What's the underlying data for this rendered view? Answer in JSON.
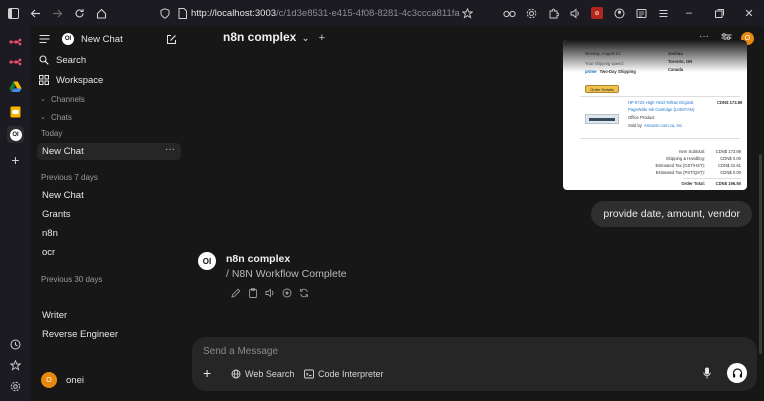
{
  "browser": {
    "url_host": "http://localhost:3003",
    "url_path": "/c/1d3e8531-e415-4f08-8281-4c3ccca811fa"
  },
  "sidebar": {
    "new_chat": "New Chat",
    "search": "Search",
    "workspace": "Workspace",
    "channels": "Channels",
    "chats": "Chats",
    "section_today": "Today",
    "today_items": [
      {
        "label": "New Chat"
      }
    ],
    "section_prev7": "Previous 7 days",
    "prev7_items": [
      {
        "label": "New Chat"
      },
      {
        "label": "Grants"
      },
      {
        "label": "n8n"
      },
      {
        "label": "ocr"
      }
    ],
    "section_prev30": "Previous 30 days",
    "prev30_items": [
      {
        "label": "Writer"
      },
      {
        "label": "Reverse Engineer"
      }
    ],
    "user_name": "onei",
    "user_initial": "O"
  },
  "header": {
    "model_name": "n8n complex",
    "avatar_initial": "O"
  },
  "receipt": {
    "date_line": "Monday, August 21",
    "speed_label": "Your shipping speed:",
    "prime_label": "prime",
    "speed_value": "Two-Day Shipping",
    "order_details": "Order Details",
    "ship_to_name": "Joshua",
    "ship_to_city": "Toronto, ON",
    "ship_to_country": "Canada",
    "item_title_1": "HP 972X High Yield Yellow Original",
    "item_title_2": "PageWide Ink Cartridge (L0S07AN)",
    "item_category": "Office Product",
    "sold_by_label": "Sold by",
    "sold_by_value": "Amazon.com.ca, Inc.",
    "item_price": "CDN$ 173.89",
    "totals": [
      {
        "label": "Item Subtotal:",
        "value": "CDN$ 173.89"
      },
      {
        "label": "Shipping & Handling:",
        "value": "CDN$ 0.00"
      },
      {
        "label": "Estimated Tax (GST/HST):",
        "value": "CDN$ 22.61"
      },
      {
        "label": "Estimated Tax (PST/QST):",
        "value": "CDN$ 0.00"
      }
    ],
    "order_total_label": "Order Total:",
    "order_total_value": "CDN$ 196.50"
  },
  "chat": {
    "user_message": "provide date, amount, vendor",
    "assistant_name": "n8n complex",
    "assistant_message": "/ N8N Workflow Complete"
  },
  "composer": {
    "placeholder": "Send a Message",
    "web_search": "Web Search",
    "code_interpreter": "Code Interpreter"
  },
  "colors": {
    "accent_avatar": "#e8890c",
    "background": "#171717",
    "bubble": "#2f2f2f"
  }
}
